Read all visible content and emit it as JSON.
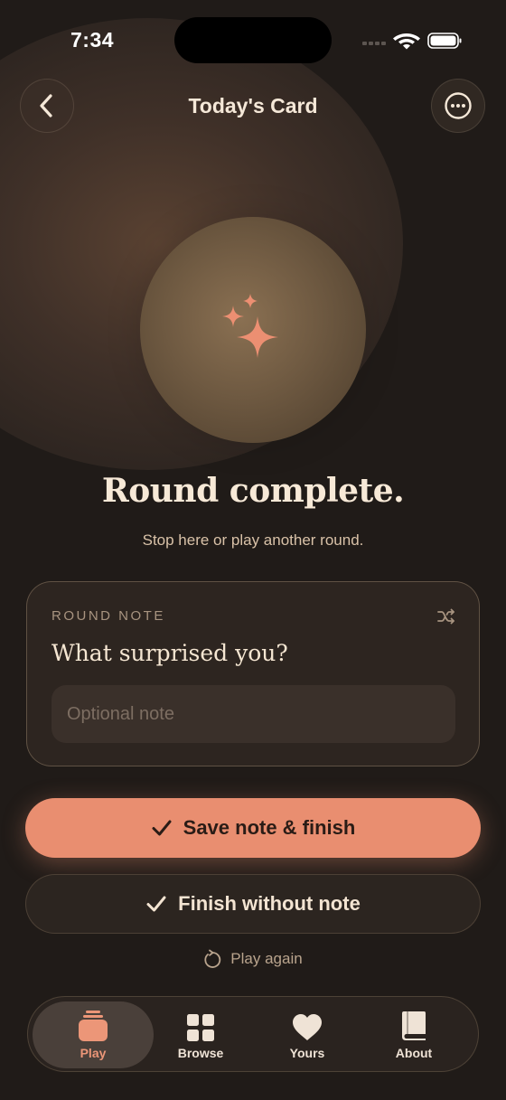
{
  "status_bar": {
    "time": "7:34"
  },
  "header": {
    "title": "Today's Card"
  },
  "hero": {
    "headline": "Round complete.",
    "subline": "Stop here or play another round."
  },
  "note_card": {
    "kicker": "ROUND NOTE",
    "question": "What surprised you?",
    "input_placeholder": "Optional note",
    "input_value": ""
  },
  "actions": {
    "primary_label": "Save note & finish",
    "secondary_label": "Finish without note",
    "tertiary_label": "Play again"
  },
  "tabbar": {
    "items": [
      {
        "label": "Play",
        "icon": "cards-stack-icon",
        "active": true
      },
      {
        "label": "Browse",
        "icon": "grid-icon",
        "active": false
      },
      {
        "label": "Yours",
        "icon": "heart-icon",
        "active": false
      },
      {
        "label": "About",
        "icon": "book-icon",
        "active": false
      }
    ]
  },
  "colors": {
    "background": "#201b18",
    "accent": "#e98e70",
    "card": "#2d2520",
    "text": "#f5e8d8"
  }
}
